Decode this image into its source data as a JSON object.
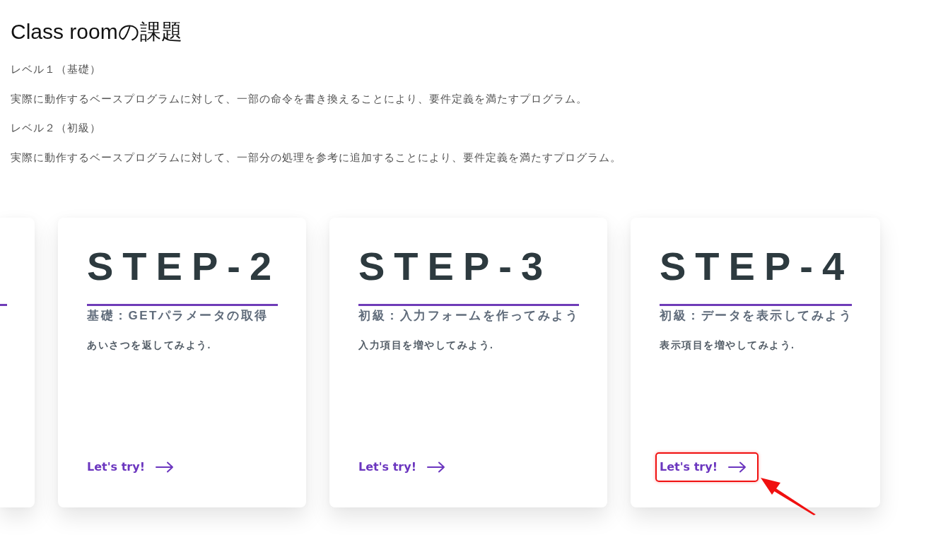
{
  "page": {
    "title": "Class roomの課題"
  },
  "levels": [
    {
      "label": "レベル１（基礎）",
      "description": "実際に動作するベースプログラムに対して、一部の命令を書き換えることにより、要件定義を満たすプログラム。"
    },
    {
      "label": "レベル２（初級）",
      "description": "実際に動作するベースプログラムに対して、一部分の処理を参考に追加することにより、要件定義を満たすプログラム。"
    }
  ],
  "cards": [
    {
      "kind": "clipped"
    },
    {
      "kind": "full",
      "step": "STEP-2",
      "subtitle": "基礎：GETパラメータの取得",
      "description": "あいさつを返してみよう.",
      "link": {
        "label": "Let's try!",
        "highlighted": false
      }
    },
    {
      "kind": "full",
      "step": "STEP-3",
      "subtitle": "初級：入力フォームを作ってみよう",
      "description": "入力項目を増やしてみよう.",
      "link": {
        "label": "Let's try!",
        "highlighted": false
      }
    },
    {
      "kind": "full",
      "step": "STEP-4",
      "subtitle": "初級：データを表示してみよう",
      "description": "表示項目を増やしてみよう.",
      "link": {
        "label": "Let's try!",
        "highlighted": true
      }
    }
  ]
}
